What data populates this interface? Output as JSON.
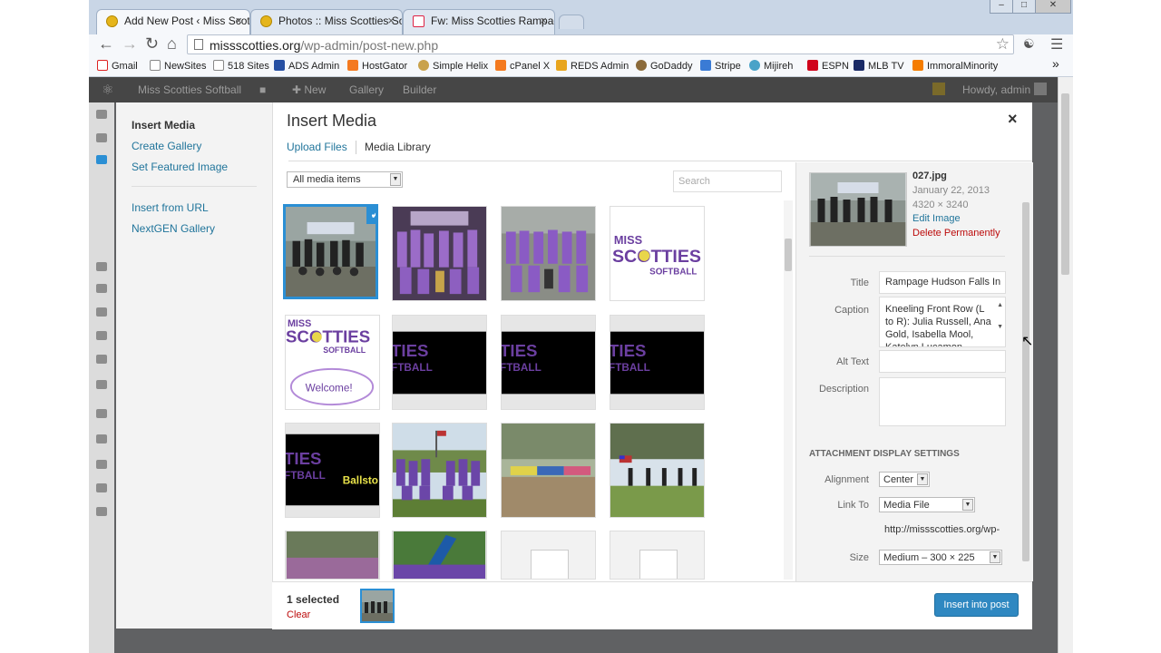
{
  "browser": {
    "tabs": [
      {
        "title": "Add New Post ‹ Miss Scot",
        "active": true
      },
      {
        "title": "Photos :: Miss Scotties Sof",
        "active": false
      },
      {
        "title": "Fw: Miss Scotties Rampag",
        "active": false
      }
    ],
    "tab_close": "×",
    "url_host": "missscotties.org",
    "url_path": "/wp-admin/post-new.php",
    "bookmarks": [
      "Gmail",
      "NewSites",
      "518 Sites",
      "ADS Admin",
      "HostGator",
      "Simple Helix",
      "cPanel X",
      "REDS Admin",
      "GoDaddy",
      "Stripe",
      "Mijireh",
      "ESPN",
      "MLB TV",
      "ImmoralMinority"
    ],
    "bookmarks_more": "»"
  },
  "admin_bar": {
    "site_name": "Miss Scotties Softball",
    "new_label": "New",
    "gallery_label": "Gallery",
    "builder_label": "Builder",
    "greeting": "Howdy, admin"
  },
  "modal": {
    "title": "Insert Media",
    "close": "×",
    "menu": {
      "insert_media": "Insert Media",
      "create_gallery": "Create Gallery",
      "set_featured": "Set Featured Image",
      "insert_url": "Insert from URL",
      "nextgen": "NextGEN Gallery"
    },
    "router": {
      "upload": "Upload Files",
      "library": "Media Library"
    },
    "filter_value": "All media items",
    "search_placeholder": "Search",
    "grid_text": {
      "logo_line1": "MISS",
      "logo_line2": "SCOTTIES",
      "logo_line3": "SOFTBALL",
      "welcome": "Welcome!",
      "ties": "TIES",
      "ftball": "FTBALL",
      "ballst": "Ballsto"
    },
    "details": {
      "filename": "027.jpg",
      "date": "January 22, 2013",
      "dimensions": "4320 × 3240",
      "edit_link": "Edit Image",
      "delete_link": "Delete Permanently",
      "title_label": "Title",
      "title_value": "Rampage Hudson Falls In",
      "caption_label": "Caption",
      "caption_value": "Kneeling Front Row (L to R): Julia Russell, Ana Gold, Isabella Mool, Katelyn Lucamon",
      "alt_label": "Alt Text",
      "alt_value": "",
      "desc_label": "Description",
      "desc_value": ""
    },
    "display_settings": {
      "heading": "ATTACHMENT DISPLAY SETTINGS",
      "alignment_label": "Alignment",
      "alignment_value": "Center",
      "link_label": "Link To",
      "link_value": "Media File",
      "link_url": "http://missscotties.org/wp-",
      "size_label": "Size",
      "size_value": "Medium – 300 × 225"
    },
    "footer": {
      "selected_count": "1 selected",
      "clear_label": "Clear",
      "insert_button": "Insert into post"
    }
  },
  "colors": {
    "accent": "#2b8fd4",
    "link": "#21759b",
    "delete": "#bc0b0b",
    "button": "#2f88c1",
    "softball_purple": "#6b3fa0"
  }
}
